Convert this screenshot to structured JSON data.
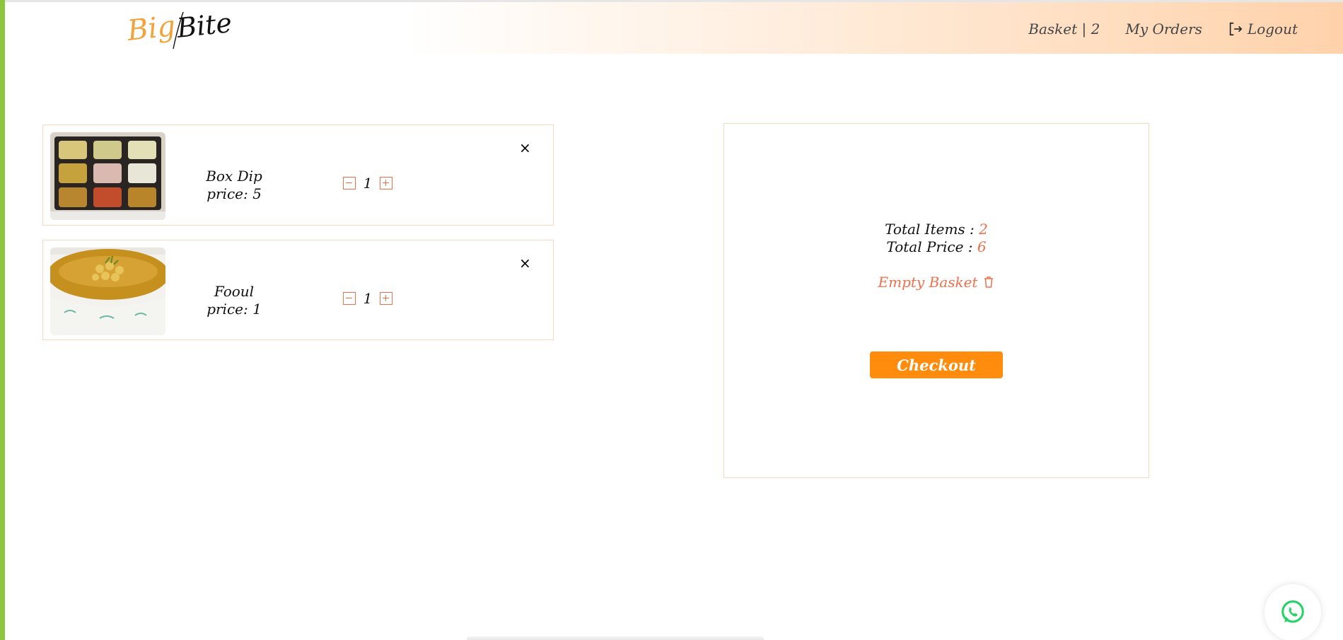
{
  "brand": {
    "part1": "Big",
    "part2": "Bite",
    "color1": "#f2a33a",
    "color2": "#111111"
  },
  "nav": {
    "basket_label": "Basket | 2",
    "orders_label": "My Orders",
    "logout_label": "Logout",
    "logout_icon": "logout-icon"
  },
  "cart": {
    "items": [
      {
        "name": "Box Dip",
        "price_label": "price: 5",
        "quantity": "1",
        "remove_icon": "×"
      },
      {
        "name": "Fooul",
        "price_label": "price: 1",
        "quantity": "1",
        "remove_icon": "×"
      }
    ]
  },
  "summary": {
    "total_items_label": "Total Items :",
    "total_items_value": "2",
    "total_price_label": "Total Price :",
    "total_price_value": "6",
    "empty_basket_label": "Empty Basket",
    "checkout_label": "Checkout"
  },
  "colors": {
    "accent": "#f0704c",
    "checkout": "#ff8c0d",
    "sidebar": "#8cc63f",
    "border": "#f7d9bd",
    "whatsapp": "#25d366"
  }
}
